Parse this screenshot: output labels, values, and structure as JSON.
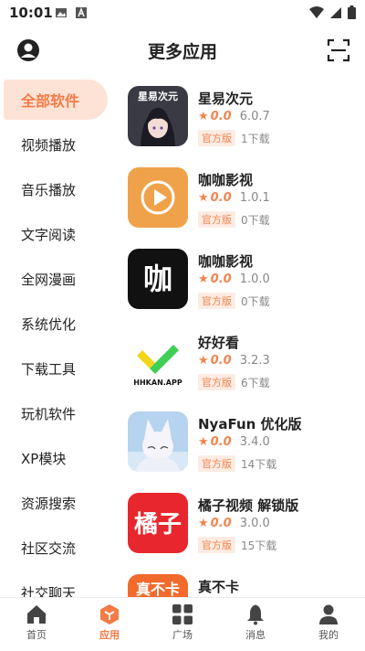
{
  "status_bar": {
    "time": "10:01"
  },
  "header": {
    "title": "更多应用"
  },
  "sidebar": {
    "items": [
      {
        "label": "全部软件",
        "active": true
      },
      {
        "label": "视频播放"
      },
      {
        "label": "音乐播放"
      },
      {
        "label": "文字阅读"
      },
      {
        "label": "全网漫画"
      },
      {
        "label": "系统优化"
      },
      {
        "label": "下载工具"
      },
      {
        "label": "玩机软件"
      },
      {
        "label": "XP模块"
      },
      {
        "label": "资源搜索"
      },
      {
        "label": "社区交流"
      },
      {
        "label": "社交聊天"
      }
    ]
  },
  "apps": [
    {
      "name": "星易次元",
      "rating": "0.0",
      "version": "6.0.7",
      "badge": "官方版",
      "downloads": "1下载",
      "icon_text": "星易次元",
      "icon": "anime-girl-icon"
    },
    {
      "name": "咖咖影视",
      "rating": "0.0",
      "version": "1.0.1",
      "badge": "官方版",
      "downloads": "0下载",
      "icon": "play-icon",
      "icon_color": "#f0a24a"
    },
    {
      "name": "咖咖影视",
      "rating": "0.0",
      "version": "1.0.0",
      "badge": "官方版",
      "downloads": "0下载",
      "icon_text": "咖",
      "icon": "ka-logo-icon"
    },
    {
      "name": "好好看",
      "rating": "0.0",
      "version": "3.2.3",
      "badge": "官方版",
      "downloads": "6下载",
      "icon_text": "HHKAN.APP",
      "icon": "hhkan-logo-icon"
    },
    {
      "name": "NyaFun 优化版",
      "rating": "0.0",
      "version": "3.4.0",
      "badge": "官方版",
      "downloads": "14下载",
      "icon": "fox-girl-icon"
    },
    {
      "name": "橘子视频 解锁版",
      "rating": "0.0",
      "version": "3.0.0",
      "badge": "官方版",
      "downloads": "15下载",
      "icon_text": "橘子",
      "icon": "juzi-logo-icon",
      "icon_color": "#e8262d"
    },
    {
      "name": "真不卡",
      "icon_text": "真不卡",
      "icon": "zhenbuka-logo-icon",
      "icon_color": "#f26a2c"
    }
  ],
  "tabbar": {
    "items": [
      {
        "label": "首页",
        "icon": "home-icon"
      },
      {
        "label": "应用",
        "icon": "apps-cube-icon",
        "active": true
      },
      {
        "label": "广场",
        "icon": "grid-icon"
      },
      {
        "label": "消息",
        "icon": "bell-icon"
      },
      {
        "label": "我的",
        "icon": "person-icon"
      }
    ]
  },
  "colors": {
    "accent": "#f47a46",
    "accent_bg": "#fde3d6"
  }
}
